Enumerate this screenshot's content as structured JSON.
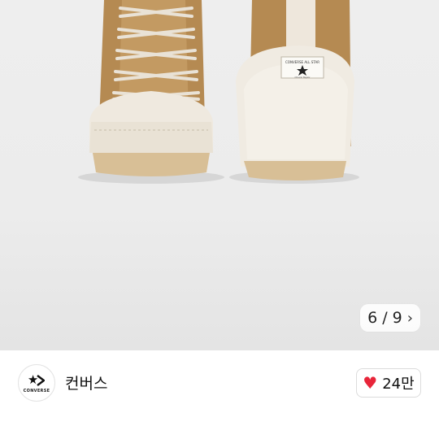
{
  "gallery": {
    "current": "6",
    "separator": "/",
    "total": "9",
    "next_icon": "chevron-right-icon"
  },
  "brand": {
    "name": "컨버스",
    "logo_text": "CONVERSE"
  },
  "likes": {
    "icon": "heart-icon",
    "count": "24만",
    "color": "#e8253a"
  },
  "product_image": {
    "heel_label_line1": "CONVERSE ALL STAR",
    "heel_label_line2": "Chuck Taylor"
  }
}
